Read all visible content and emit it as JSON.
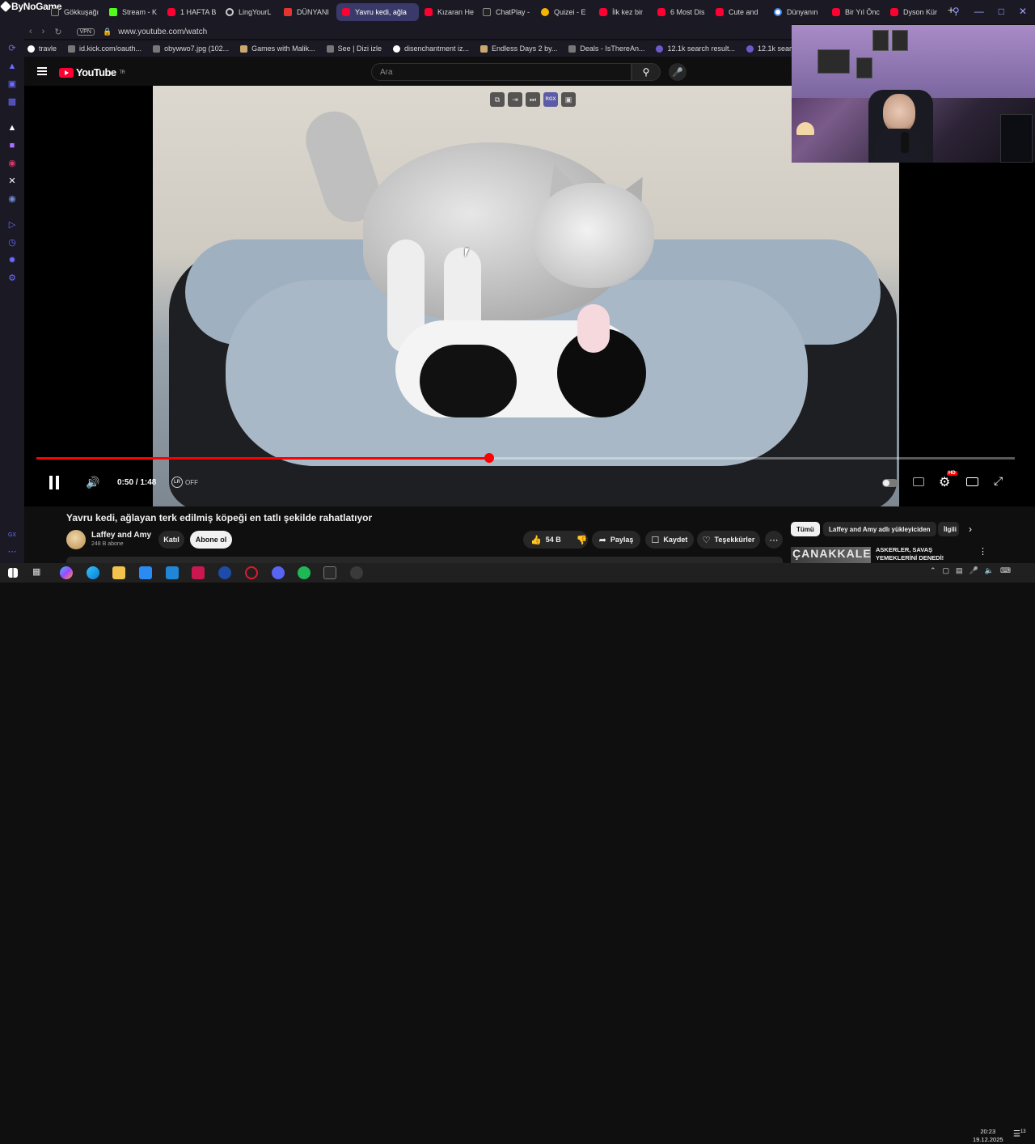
{
  "browser": {
    "brand": "ByNoGame",
    "tabs": [
      {
        "label": "Gökkuşağı",
        "icon": "opera-icon"
      },
      {
        "label": "Stream - K",
        "icon": "kick-icon"
      },
      {
        "label": "1 HAFTA B",
        "icon": "youtube-icon"
      },
      {
        "label": "LingYourL",
        "icon": "web-icon"
      },
      {
        "label": "DÜNYANI",
        "icon": "u-icon"
      },
      {
        "label": "Yavru kedi, ağla",
        "icon": "youtube-icon",
        "active": true
      },
      {
        "label": "Kızaran He",
        "icon": "youtube-icon"
      },
      {
        "label": "ChatPlay -",
        "icon": "cp-icon"
      },
      {
        "label": "Quizei - E",
        "icon": "quiz-icon"
      },
      {
        "label": "İlk kez bir",
        "icon": "youtube-icon"
      },
      {
        "label": "6 Most Dis",
        "icon": "youtube-icon"
      },
      {
        "label": "Cute and",
        "icon": "youtube-icon"
      },
      {
        "label": "Dünyanın",
        "icon": "google-icon"
      },
      {
        "label": "Bir Yıl Önc",
        "icon": "youtube-icon"
      },
      {
        "label": "Dyson Kür",
        "icon": "youtube-icon"
      }
    ],
    "vpn_label": "VPN",
    "url": "www.youtube.com/watch",
    "bookmarks": [
      "travle",
      "id.kick.com/oauth...",
      "obywwo7.jpg (102...",
      "Games with Malik...",
      "See | Dizi izle",
      "disenchantment iz...",
      "Endless Days 2 by...",
      "Deals - IsThereAn...",
      "12.1k search result...",
      "12.1k search result..."
    ],
    "sidebar_footer": "GX"
  },
  "youtube": {
    "logo_text": "YouTube",
    "region": "TR",
    "search_placeholder": "Ara",
    "player": {
      "time_display": "0:50 / 1:48",
      "progress_fraction": 0.463,
      "lr_label": "OFF",
      "hd_badge": "HD",
      "top_overlay_label": "RGX"
    },
    "video": {
      "title": "Yavru kedi, ağlayan terk edilmiş köpeği en tatlı şekilde rahatlatıyor",
      "channel": "Laffey and Amy",
      "subscribers": "248 B abone",
      "join_label": "Katıl",
      "subscribe_label": "Abone ol",
      "likes": "54 B",
      "share_label": "Paylaş",
      "save_label": "Kaydet",
      "thanks_label": "Teşekkürler"
    },
    "chips": [
      "Tümü",
      "Laffey and Amy adlı yükleyiciden",
      "İlgili"
    ],
    "recommendation": {
      "thumb_text": "ÇANAKKALE",
      "title": "ASKERLER, SAVAŞ YEMEKLERİNİ DENEDİ!"
    }
  },
  "taskbar": {
    "time": "20:23",
    "date": "19.12.2025",
    "notifications": "13"
  }
}
